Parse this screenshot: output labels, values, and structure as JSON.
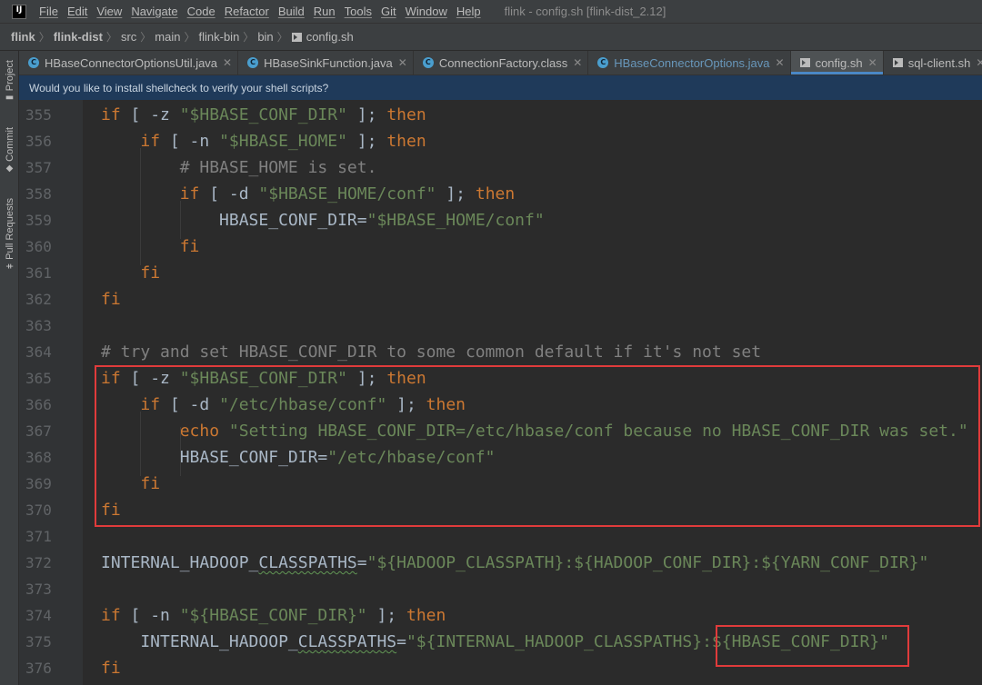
{
  "app": {
    "logo_text": "IJ",
    "menu": [
      "File",
      "Edit",
      "View",
      "Navigate",
      "Code",
      "Refactor",
      "Build",
      "Run",
      "Tools",
      "Git",
      "Window",
      "Help"
    ],
    "window_title": "flink - config.sh [flink-dist_2.12]"
  },
  "breadcrumb": [
    "flink",
    "flink-dist",
    "src",
    "main",
    "flink-bin",
    "bin",
    "config.sh"
  ],
  "tool_stripe": {
    "project": "Project",
    "commit": "Commit",
    "pull_requests": "Pull Requests"
  },
  "tabs": [
    {
      "label": "HBaseConnectorOptionsUtil.java",
      "icon": "class-icon",
      "active": false
    },
    {
      "label": "HBaseSinkFunction.java",
      "icon": "class-icon",
      "active": false
    },
    {
      "label": "ConnectionFactory.class",
      "icon": "class-icon",
      "active": false
    },
    {
      "label": "HBaseConnectorOptions.java",
      "icon": "class-icon",
      "active": false
    },
    {
      "label": "config.sh",
      "icon": "shell-script-icon",
      "active": true
    },
    {
      "label": "sql-client.sh",
      "icon": "shell-script-icon",
      "active": false
    }
  ],
  "banner": {
    "text": "Would you like to install shellcheck to verify your shell scripts?"
  },
  "code": {
    "lines": [
      {
        "no": "355",
        "tokens": [
          {
            "t": "if",
            "c": "kw"
          },
          {
            "t": " [ -z ",
            "c": "plain"
          },
          {
            "t": "\"$HBASE_CONF_DIR\"",
            "c": "str"
          },
          {
            "t": " ]; ",
            "c": "plain"
          },
          {
            "t": "then",
            "c": "kw"
          }
        ]
      },
      {
        "no": "356",
        "tokens": [
          {
            "t": "    ",
            "c": "plain"
          },
          {
            "t": "if",
            "c": "kw"
          },
          {
            "t": " [ -n ",
            "c": "plain"
          },
          {
            "t": "\"$HBASE_HOME\"",
            "c": "str"
          },
          {
            "t": " ]; ",
            "c": "plain"
          },
          {
            "t": "then",
            "c": "kw"
          }
        ]
      },
      {
        "no": "357",
        "tokens": [
          {
            "t": "        ",
            "c": "plain"
          },
          {
            "t": "# HBASE_HOME is set.",
            "c": "cmt"
          }
        ]
      },
      {
        "no": "358",
        "tokens": [
          {
            "t": "        ",
            "c": "plain"
          },
          {
            "t": "if",
            "c": "kw"
          },
          {
            "t": " [ -d ",
            "c": "plain"
          },
          {
            "t": "\"$HBASE_HOME/conf\"",
            "c": "str"
          },
          {
            "t": " ]; ",
            "c": "plain"
          },
          {
            "t": "then",
            "c": "kw"
          }
        ]
      },
      {
        "no": "359",
        "tokens": [
          {
            "t": "            HBASE_CONF_DIR=",
            "c": "plain"
          },
          {
            "t": "\"$HBASE_HOME/conf\"",
            "c": "str"
          }
        ]
      },
      {
        "no": "360",
        "tokens": [
          {
            "t": "        ",
            "c": "plain"
          },
          {
            "t": "fi",
            "c": "kw"
          }
        ]
      },
      {
        "no": "361",
        "tokens": [
          {
            "t": "    ",
            "c": "plain"
          },
          {
            "t": "fi",
            "c": "kw"
          }
        ]
      },
      {
        "no": "362",
        "tokens": [
          {
            "t": "fi",
            "c": "kw"
          }
        ]
      },
      {
        "no": "363",
        "tokens": []
      },
      {
        "no": "364",
        "tokens": [
          {
            "t": "# try and set HBASE_CONF_DIR to some common default if it's not set",
            "c": "cmt"
          }
        ]
      },
      {
        "no": "365",
        "tokens": [
          {
            "t": "if",
            "c": "kw"
          },
          {
            "t": " [ -z ",
            "c": "plain"
          },
          {
            "t": "\"$HBASE_CONF_DIR\"",
            "c": "str"
          },
          {
            "t": " ]; ",
            "c": "plain"
          },
          {
            "t": "then",
            "c": "kw"
          }
        ]
      },
      {
        "no": "366",
        "tokens": [
          {
            "t": "    ",
            "c": "plain"
          },
          {
            "t": "if",
            "c": "kw"
          },
          {
            "t": " [ -d ",
            "c": "plain"
          },
          {
            "t": "\"/etc/hbase/conf\"",
            "c": "str"
          },
          {
            "t": " ]; ",
            "c": "plain"
          },
          {
            "t": "then",
            "c": "kw"
          }
        ]
      },
      {
        "no": "367",
        "tokens": [
          {
            "t": "        ",
            "c": "plain"
          },
          {
            "t": "echo",
            "c": "kw"
          },
          {
            "t": " ",
            "c": "plain"
          },
          {
            "t": "\"Setting HBASE_CONF_DIR=/etc/hbase/conf because no HBASE_CONF_DIR was set.\"",
            "c": "str"
          }
        ]
      },
      {
        "no": "368",
        "tokens": [
          {
            "t": "        HBASE_CONF_DIR=",
            "c": "plain"
          },
          {
            "t": "\"/etc/hbase/conf\"",
            "c": "str"
          }
        ]
      },
      {
        "no": "369",
        "tokens": [
          {
            "t": "    ",
            "c": "plain"
          },
          {
            "t": "fi",
            "c": "kw"
          }
        ]
      },
      {
        "no": "370",
        "tokens": [
          {
            "t": "fi",
            "c": "kw"
          }
        ]
      },
      {
        "no": "371",
        "tokens": []
      },
      {
        "no": "372",
        "tokens": [
          {
            "t": "INTERNAL_HADOOP_",
            "c": "plain"
          },
          {
            "t": "CLASSPATHS",
            "c": "sq"
          },
          {
            "t": "=",
            "c": "plain"
          },
          {
            "t": "\"${HADOOP_CLASSPATH}:${HADOOP_CONF_DIR}:${YARN_CONF_DIR}\"",
            "c": "str"
          }
        ]
      },
      {
        "no": "373",
        "tokens": []
      },
      {
        "no": "374",
        "tokens": [
          {
            "t": "if",
            "c": "kw"
          },
          {
            "t": " [ -n ",
            "c": "plain"
          },
          {
            "t": "\"${HBASE_CONF_DIR}\"",
            "c": "str"
          },
          {
            "t": " ]; ",
            "c": "plain"
          },
          {
            "t": "then",
            "c": "kw"
          }
        ]
      },
      {
        "no": "375",
        "tokens": [
          {
            "t": "    INTERNAL_HADOOP_",
            "c": "plain"
          },
          {
            "t": "CLASSPATHS",
            "c": "sq"
          },
          {
            "t": "=",
            "c": "plain"
          },
          {
            "t": "\"${INTERNAL_HADOOP_CLASSPATHS}:${HBASE_CONF_DIR}\"",
            "c": "str"
          }
        ]
      },
      {
        "no": "376",
        "tokens": [
          {
            "t": "fi",
            "c": "kw"
          }
        ]
      }
    ]
  },
  "colors": {
    "keyword": "#cc7832",
    "string": "#6a8759",
    "comment": "#808080",
    "text": "#a9b7c6",
    "highlight_box": "#e03b3b",
    "active_tab_accent": "#4a88c7"
  }
}
